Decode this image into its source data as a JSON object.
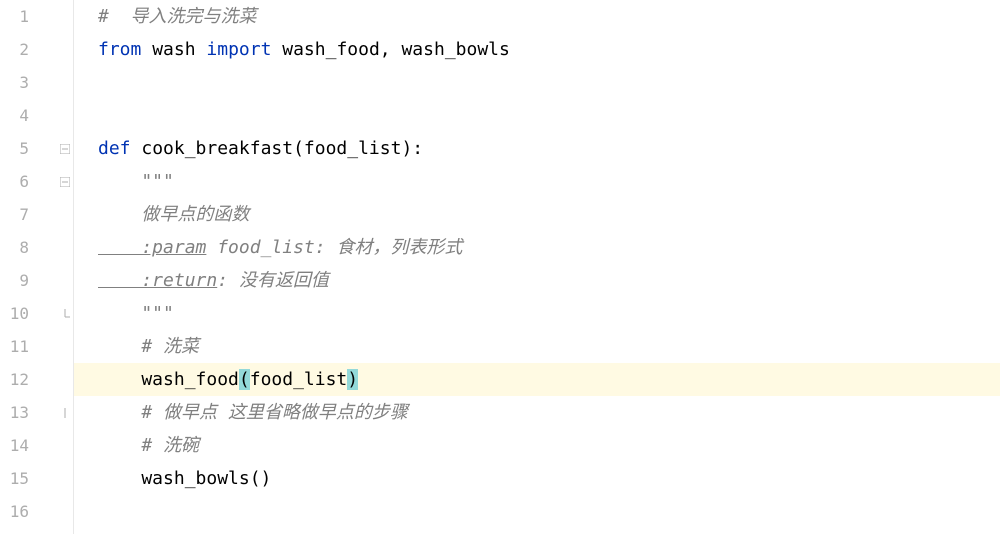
{
  "lines": {
    "ln1": "1",
    "ln2": "2",
    "ln3": "3",
    "ln4": "4",
    "ln5": "5",
    "ln6": "6",
    "ln7": "7",
    "ln8": "8",
    "ln9": "9",
    "ln10": "10",
    "ln11": "11",
    "ln12": "12",
    "ln13": "13",
    "ln14": "14",
    "ln15": "15",
    "ln16": "16"
  },
  "code": {
    "l1_comment": "#  导入洗完与洗菜",
    "l2_from": "from",
    "l2_wash": " wash ",
    "l2_import": "import",
    "l2_rest": " wash_food, wash_bowls",
    "l5_def": "def ",
    "l5_name": "cook_breakfast(food_list):",
    "l6_quotes": "    \"\"\"",
    "l7_doc": "    做早点的函数",
    "l8_param": "    :param",
    "l8_param_rest": " food_list: 食材，列表形式",
    "l9_return": "    :return",
    "l9_return_rest": ": 没有返回值",
    "l10_quotes": "    \"\"\"",
    "l11_comment": "    # 洗菜",
    "l12_call": "    wash_food",
    "l12_paren1": "(",
    "l12_arg": "food_list",
    "l12_paren2": ")",
    "l13_comment": "    # 做早点 这里省略做早点的步骤",
    "l14_comment": "    # 洗碗",
    "l15_call": "    wash_bowls()"
  },
  "active_line": 12
}
